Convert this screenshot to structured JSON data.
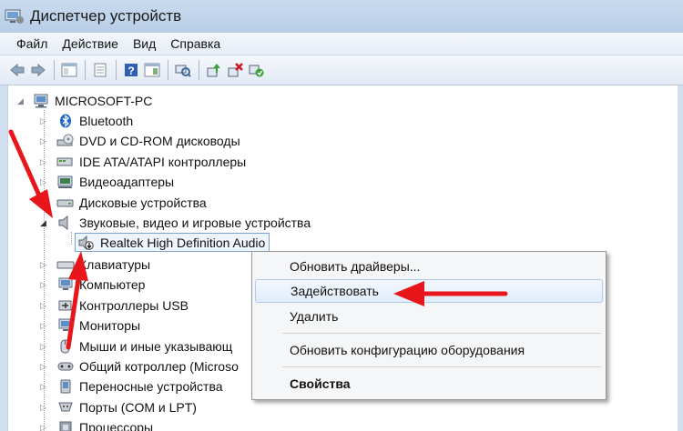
{
  "window": {
    "title": "Диспетчер устройств"
  },
  "menu": [
    "Файл",
    "Действие",
    "Вид",
    "Справка"
  ],
  "tree": {
    "root": "MICROSOFT-PC",
    "items": [
      "Bluetooth",
      "DVD и CD-ROM дисководы",
      "IDE ATA/ATAPI контроллеры",
      "Видеоадаптеры",
      "Дисковые устройства",
      "Звуковые, видео и игровые устройства",
      "Realtek High Definition Audio",
      "Клавиатуры",
      "Компьютер",
      "Контроллеры USB",
      "Мониторы",
      "Мыши и иные указывающ",
      "Общий котроллер (Microso",
      "Переносные устройства",
      "Порты (COM и LPT)",
      "Процессоры"
    ]
  },
  "context_menu": {
    "update_drivers": "Обновить драйверы...",
    "enable": "Задействовать",
    "delete": "Удалить",
    "scan_hardware": "Обновить конфигурацию оборудования",
    "properties": "Свойства"
  },
  "colors": {
    "annotation_arrow": "#e8161b",
    "selection_border": "#7da2ce"
  }
}
